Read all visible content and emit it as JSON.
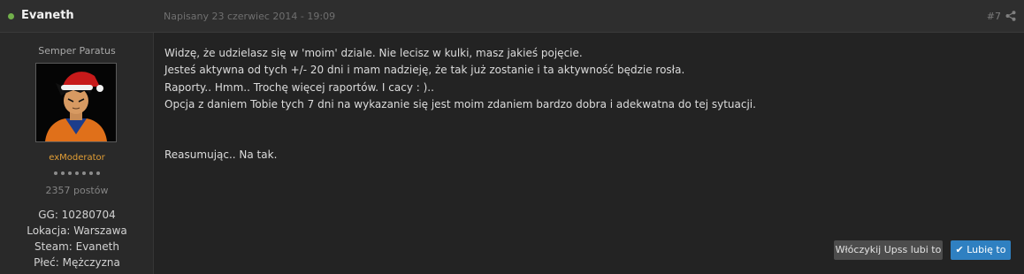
{
  "header": {
    "author": "Evaneth",
    "date": "Napisany 23 czerwiec 2014 - 19:09",
    "post_number": "#7",
    "share_icon": "share-icon",
    "online_color": "#72b04b"
  },
  "sidebar": {
    "title": "Semper Paratus",
    "rank": "exModerator",
    "pips": 7,
    "posts": "2357 postów",
    "info": [
      "GG: 10280704",
      "Lokacja: Warszawa",
      "Steam: Evaneth",
      "Płeć: Mężczyzna"
    ]
  },
  "post": {
    "lines": [
      "Widzę, że udzielasz się w 'moim' dziale. Nie lecisz w kulki, masz jakieś pojęcie.",
      "Jesteś aktywna od tych +/- 20 dni i mam nadzieję, że tak już zostanie i ta aktywność będzie rosła.",
      "Raporty.. Hmm.. Trochę więcej raportów. I cacy : ).. ",
      "Opcja z daniem Tobie tych 7 dni na wykazanie się jest moim zdaniem bardzo dobra i adekwatna do tej sytuacji."
    ],
    "closing": "Reasumując.. Na tak."
  },
  "actions": {
    "who_liked": "Włóczykij Upss lubi to",
    "like_check": "✔",
    "like": "Lubię to"
  },
  "colors": {
    "accent": "#2f80c1",
    "rank": "#e29e35"
  }
}
